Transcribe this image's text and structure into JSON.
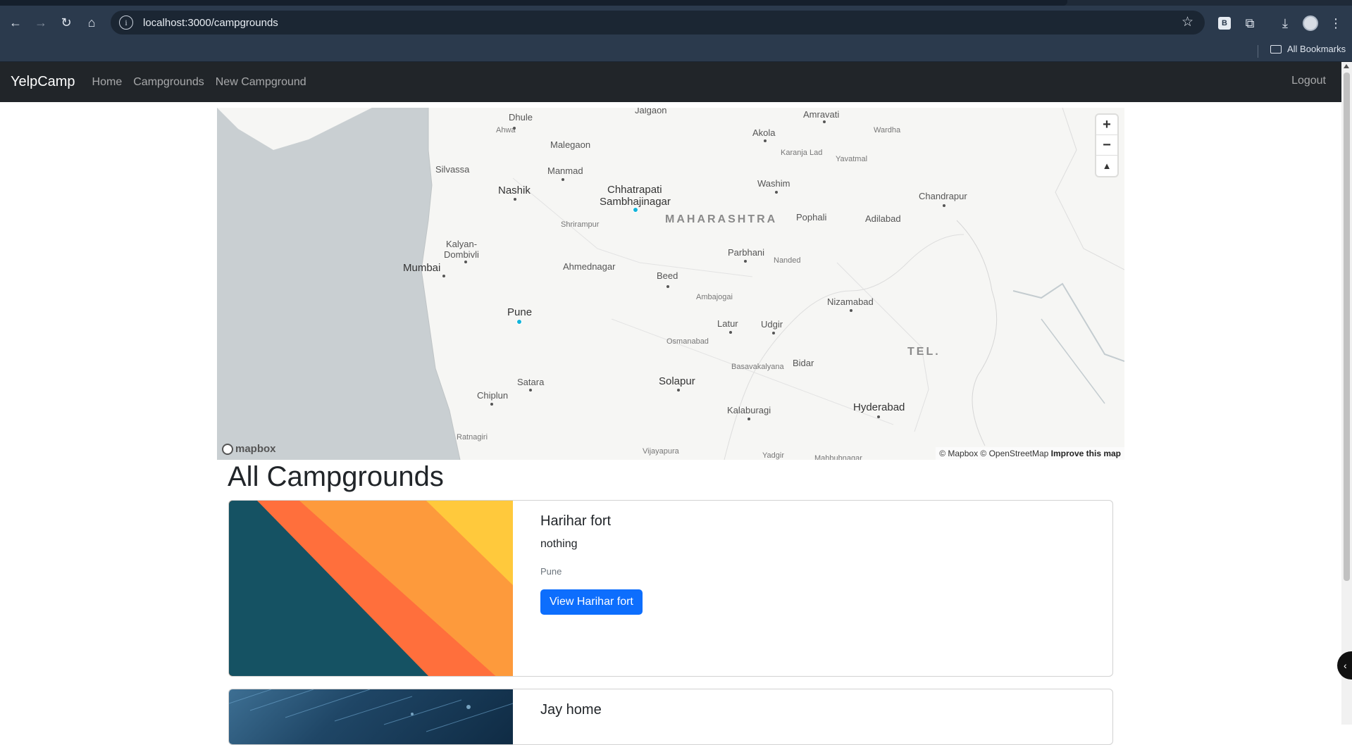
{
  "browser": {
    "url": "localhost:3000/campgrounds",
    "bookmarks_label": "All Bookmarks",
    "extension_badge": "B"
  },
  "navbar": {
    "brand": "YelpCamp",
    "links": [
      "Home",
      "Campgrounds",
      "New Campground"
    ],
    "logout": "Logout"
  },
  "map": {
    "labels": {
      "dhule": "Dhule",
      "jalgaon": "Jalgaon",
      "amravati": "Amravati",
      "akola": "Akola",
      "wardha": "Wardha",
      "ahwa": "Ahwa",
      "malegaon": "Malegaon",
      "karanja": "Karanja Lad",
      "yavatmal": "Yavatmal",
      "silvassa": "Silvassa",
      "manmad": "Manmad",
      "nashik": "Nashik",
      "chhatrapati": "Chhatrapati",
      "sambhajinagar": "Sambhajinagar",
      "washim": "Washim",
      "chandrapur": "Chandrapur",
      "maharashtra": "MAHARASHTRA",
      "pophali": "Pophali",
      "adilabad": "Adilabad",
      "shrirampur": "Shrirampur",
      "kalyan": "Kalyan-",
      "dombivli": "Dombivli",
      "parbhani": "Parbhani",
      "mumbai": "Mumbai",
      "ahmednagar": "Ahmednagar",
      "nanded": "Nanded",
      "beed": "Beed",
      "ambajogai": "Ambajogai",
      "nizamabad": "Nizamabad",
      "pune": "Pune",
      "latur": "Latur",
      "udgir": "Udgir",
      "osmanabad": "Osmanabad",
      "tel": "TEL.",
      "basavakalyana": "Basavakalyana",
      "bidar": "Bidar",
      "satara": "Satara",
      "solapur": "Solapur",
      "chiplun": "Chiplun",
      "hyderabad": "Hyderabad",
      "kalaburagi": "Kalaburagi",
      "ratnagiri": "Ratnagiri",
      "vijayapura": "Vijayapura",
      "yadgir": "Yadgir",
      "mahbubnagar": "Mahbubnagar"
    },
    "zoom_in": "+",
    "zoom_out": "−",
    "compass": "▲",
    "logo": "mapbox",
    "attribution": "© Mapbox © OpenStreetMap",
    "improve": "Improve this map"
  },
  "page_title": "All Campgrounds",
  "campgrounds": [
    {
      "title": "Harihar fort",
      "description": "nothing",
      "location": "Pune",
      "button": "View Harihar fort"
    },
    {
      "title": "Jay home"
    }
  ],
  "colors": {
    "navbar_bg": "#212529",
    "primary": "#0d6efd",
    "marker": "#11b4da"
  }
}
